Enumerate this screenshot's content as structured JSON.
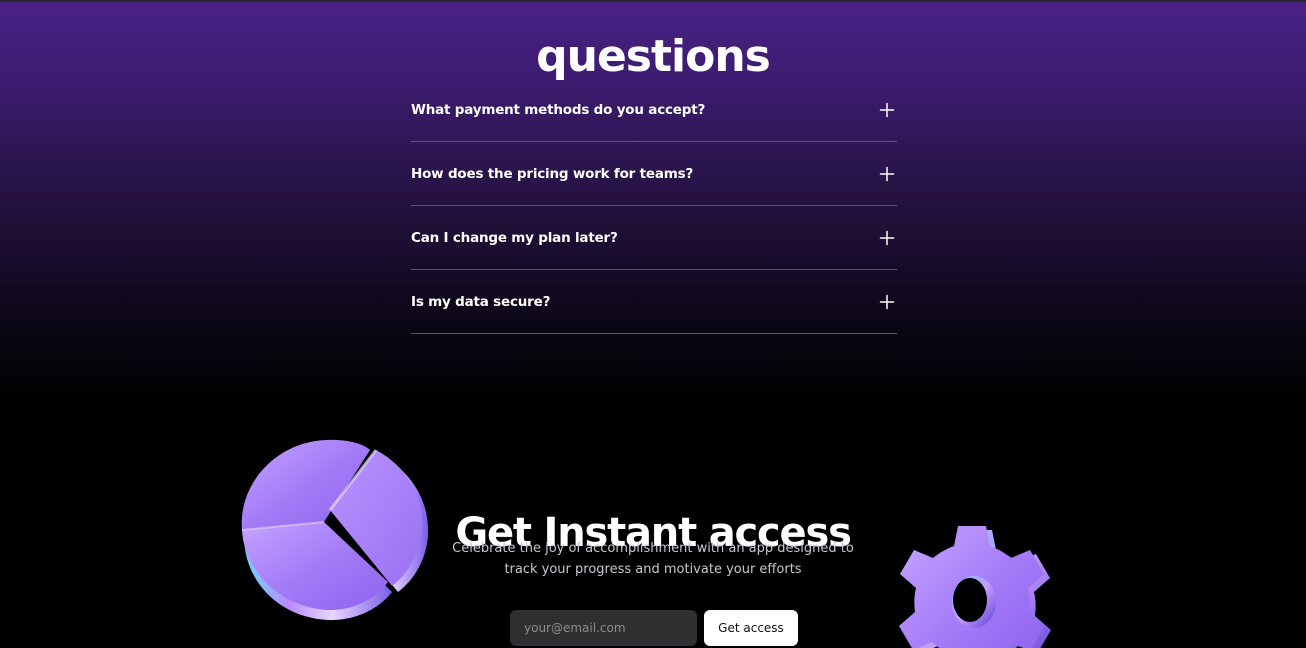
{
  "faq": {
    "title": "questions",
    "items": [
      {
        "question": "What payment methods do you accept?"
      },
      {
        "question": "How does the pricing work for teams?"
      },
      {
        "question": "Can I change my plan later?"
      },
      {
        "question": "Is my data secure?"
      }
    ]
  },
  "cta": {
    "title": "Get Instant access",
    "description": "Celebrate the joy of accomplishment with an app designed to track your progress and motivate your efforts",
    "email_placeholder": "your@email.com",
    "button_label": "Get access"
  },
  "icons": {
    "faq_toggle": "plus-icon",
    "left_illustration": "pie-chart-3d-illustration",
    "right_illustration": "gear-3d-illustration"
  },
  "colors": {
    "accent_purple": "#a97cff",
    "gradient_top": "#4a2287",
    "background": "#000000"
  }
}
